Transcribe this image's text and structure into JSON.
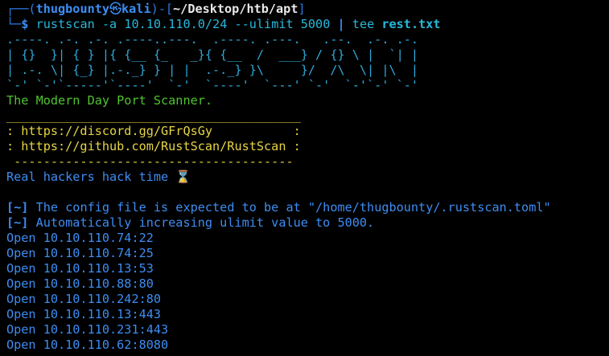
{
  "prompt": {
    "corner_top": "┌──(",
    "user": "thugbounty",
    "at_icon": "㉿",
    "host": "kali",
    "mid": ")-[",
    "path": "~/Desktop/htb/apt",
    "end": "]",
    "corner_bottom": "└─",
    "dollar": "$",
    "command": " rustscan -a 10.10.110.0/24 --ulimit 5000 ",
    "pipe": "|",
    "tee": " tee ",
    "outfile": "rest.txt"
  },
  "banner": [
    ".----. .-. .-. .----..---.  .----. .---.   .--.  .-. .-.",
    "| {}  }| { } |{ {__ {_   _}{ {__  /  ___} / {} \\ |  `| |",
    "| .-. \\| {_} |.-._} } | |  .-._} }\\     }/  /\\  \\| |\\  |",
    "`-' `-'`-----'`----'  `-'  `----'  `---' `-'  `-'`-' `-'"
  ],
  "tagline": "The Modern Day Port Scanner.",
  "links": {
    "sep_top": "________________________________________",
    "discord": ": https://discord.gg/GFrQsGy           :",
    "github": ": https://github.com/RustScan/RustScan :",
    "sep_bottom": " --------------------------------------"
  },
  "quote": "Real hackers hack time ⌛",
  "messages": [
    {
      "tag": "[~]",
      "text": " The config file is expected to be at \"/home/thugbounty/.rustscan.toml\""
    },
    {
      "tag": "[~]",
      "text": " Automatically increasing ulimit value to 5000."
    }
  ],
  "open_ports": [
    "Open 10.10.110.74:22",
    "Open 10.10.110.74:25",
    "Open 10.10.110.13:53",
    "Open 10.10.110.88:80",
    "Open 10.10.110.242:80",
    "Open 10.10.110.13:443",
    "Open 10.10.110.231:443",
    "Open 10.10.110.62:8080"
  ],
  "colors": {
    "background": "#000000",
    "prompt_blue": "#3d8df2",
    "banner_cyan": "#2fa8d8",
    "green": "#4fc42e",
    "yellow": "#e5d442"
  }
}
